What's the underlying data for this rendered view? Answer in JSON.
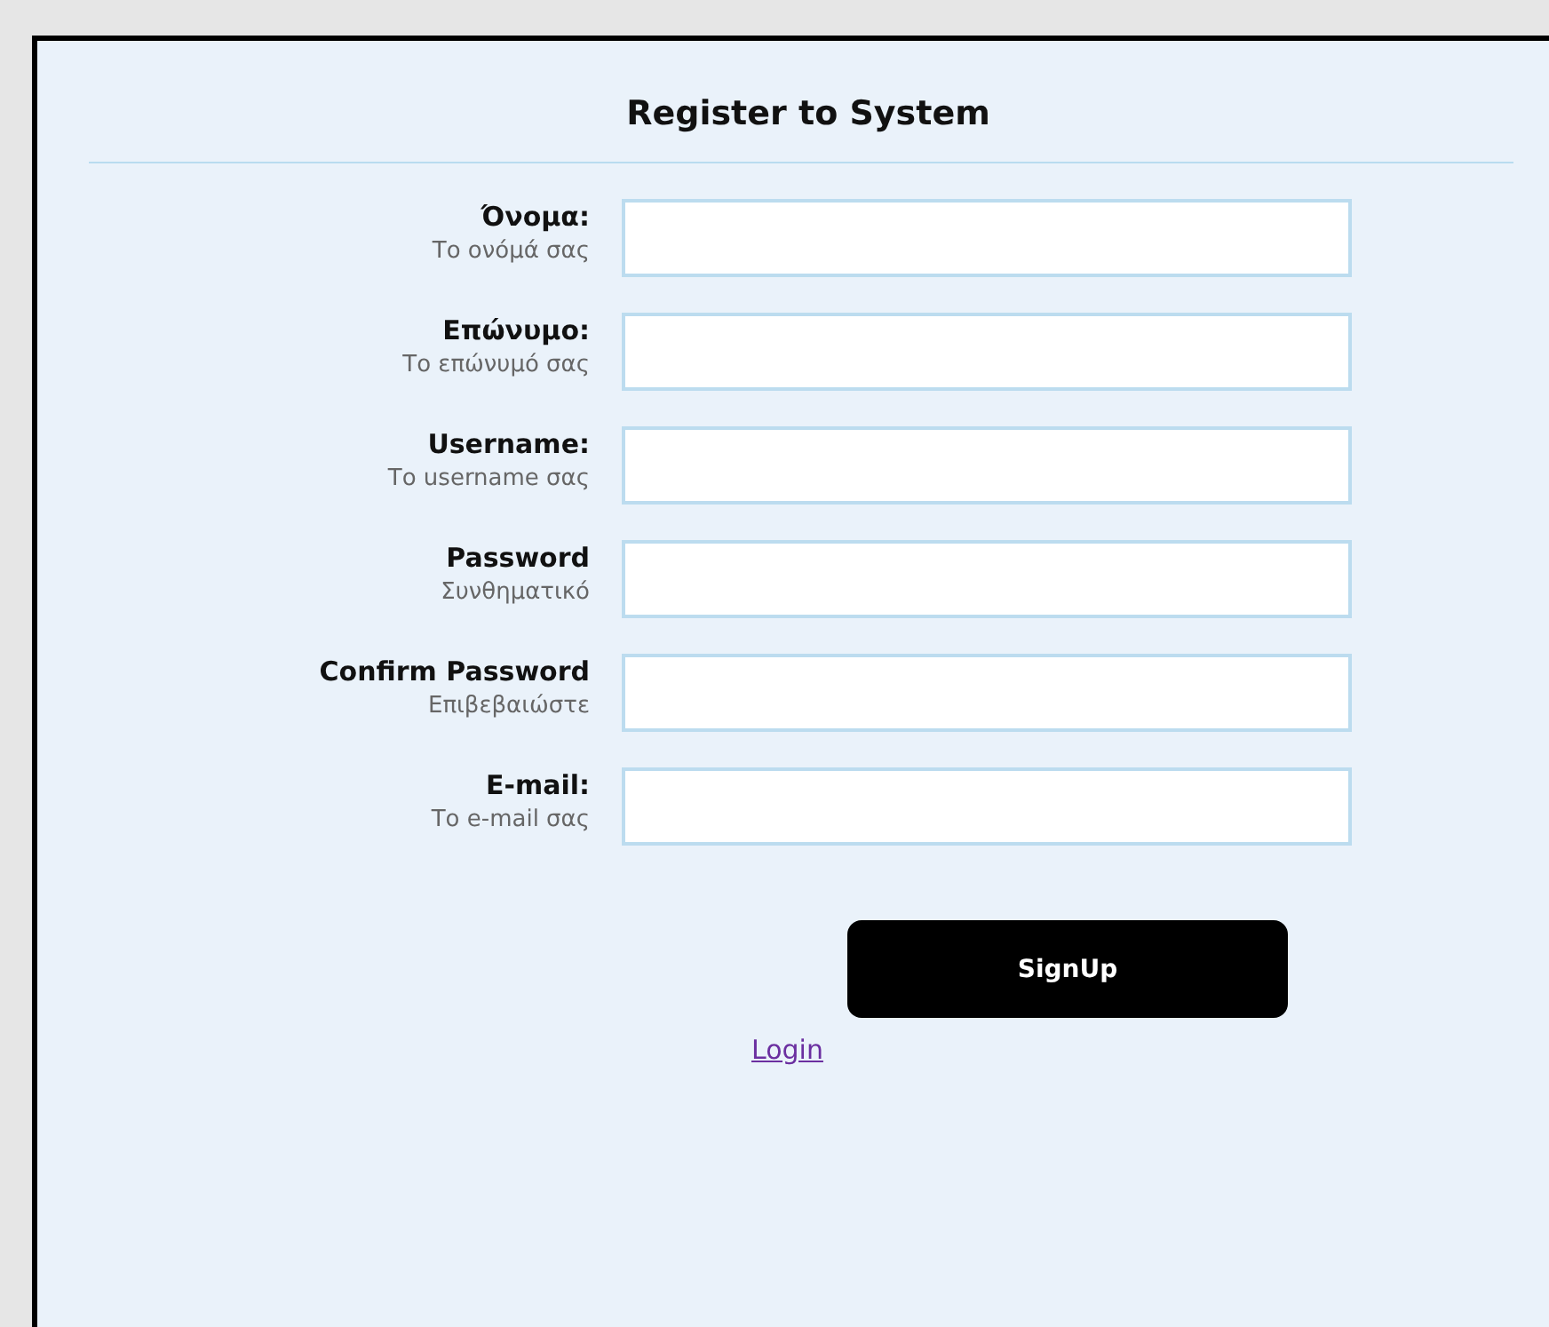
{
  "title": "Register to System",
  "fields": [
    {
      "label": "Όνομα:",
      "hint": "Το ονόμά σας"
    },
    {
      "label": "Επώνυμο:",
      "hint": "Το επώνυμό σας"
    },
    {
      "label": "Username:",
      "hint": "Το username σας"
    },
    {
      "label": "Password",
      "hint": "Συνθηματικό"
    },
    {
      "label": "Confirm Password",
      "hint": "Επιβεβαιώστε"
    },
    {
      "label": "E-mail:",
      "hint": "Το e-mail σας"
    }
  ],
  "submit": "SignUp",
  "login_link": "Login"
}
